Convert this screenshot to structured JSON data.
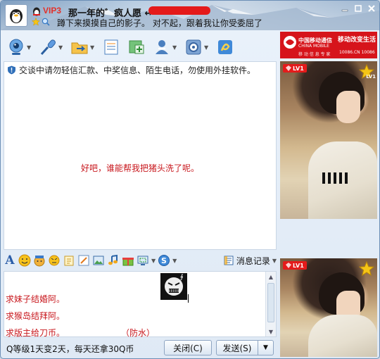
{
  "header": {
    "vip_label": "VIP3",
    "contact_name": "那一年的゛疯人愿",
    "name_suffix": "↔",
    "signature": "蹲下来摸摸自己的影子。 对不起，跟着我让你受委屈了"
  },
  "toolbar": {
    "tools": [
      "video-call",
      "voice-call",
      "transfer-file",
      "send-sms",
      "create-group",
      "remote-assist",
      "app-settings",
      "qq-zone"
    ]
  },
  "chat": {
    "security_notice": "交谈中请勿轻信汇款、中奖信息、陌生电话，勿使用外挂软件。",
    "messages": [
      "好吧，谁能帮我把猪头洗了呢。"
    ]
  },
  "formatbar": {
    "font_glyph": "A",
    "history_label": "消息记录",
    "history_arrow": "▼"
  },
  "input": {
    "lines": [
      "求妹子结婚阿。",
      "求猴岛结拜阿。",
      "求版主给刀币。"
    ],
    "extra_note": "（防水）",
    "sticker_text": "∮"
  },
  "footer": {
    "status_text": "Q等级1天变2天，每天还拿30Q币",
    "close_label": "关闭(C)",
    "send_label": "发送(S)",
    "send_dropdown": "▼"
  },
  "ad": {
    "line1": "中国移动通信",
    "line2": "CHINA MOBILE",
    "slogan": "移动改变生活",
    "phone": "10086.CN  10086",
    "subtitle": "移 动 信 息 专 家"
  },
  "show": {
    "level_badge_1": "LV1",
    "star_level_1": "LV1",
    "level_badge_2": "LV1"
  },
  "colors": {
    "accent_red": "#e41a1a",
    "message_red": "#c8171d",
    "window_border": "#6c8fb6"
  }
}
